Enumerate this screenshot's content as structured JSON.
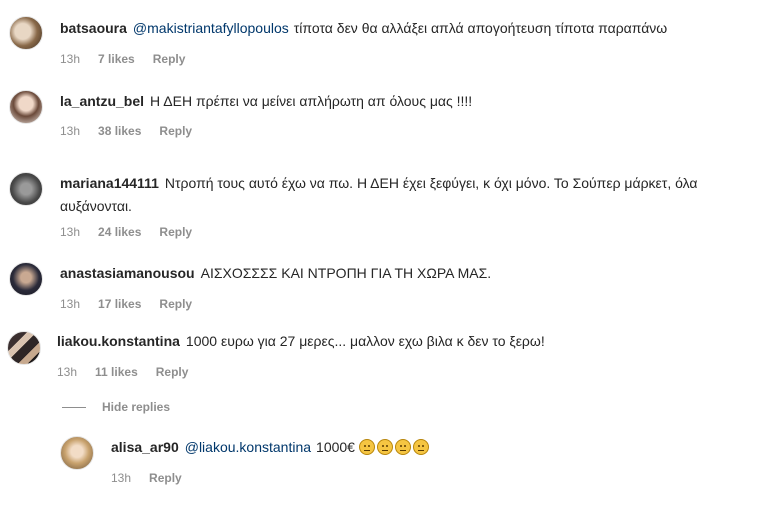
{
  "comments": [
    {
      "username": "batsaoura",
      "mention": "@makistriantafyllopoulos",
      "text": "τίποτα δεν θα αλλάξει απλά απογοήτευση τίποτα παραπάνω",
      "time": "13h",
      "likes": "7 likes",
      "reply": "Reply"
    },
    {
      "username": "la_antzu_bel",
      "text": "Η ΔΕΗ πρέπει να μείνει απλήρωτη απ όλους μας !!!!",
      "time": "13h",
      "likes": "38 likes",
      "reply": "Reply"
    },
    {
      "username": "mariana144111",
      "text": "Ντροπή τους αυτό έχω να πω. Η ΔΕΗ έχει ξεφύγει, κ όχι μόνο. Το Σούπερ μάρκετ, όλα αυξάνονται.",
      "time": "13h",
      "likes": "24 likes",
      "reply": "Reply"
    },
    {
      "username": "anastasiamanousou",
      "text": "ΑΙΣΧΟΣΣΣΣ ΚΑΙ ΝΤΡΟΠΗ ΓΙΑ ΤΗ ΧΩΡΑ ΜΑΣ.",
      "time": "13h",
      "likes": "17 likes",
      "reply": "Reply"
    },
    {
      "username": "liakou.konstantina",
      "text": "1000 ευρω για 27 μερες... μαλλον εχω βιλα κ δεν το ξερω!",
      "time": "13h",
      "likes": "11 likes",
      "reply": "Reply"
    }
  ],
  "hide_replies": "Hide replies",
  "reply_comment": {
    "username": "alisa_ar90",
    "mention": "@liakou.konstantina",
    "text": "1000€",
    "emoji": "pensive-face-emoji",
    "emoji_count": 4,
    "time": "13h",
    "reply": "Reply"
  }
}
